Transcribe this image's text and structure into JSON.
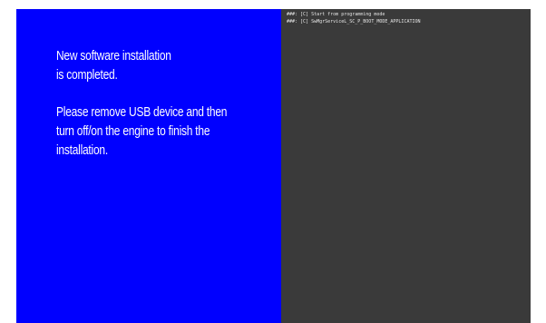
{
  "install_screen": {
    "message_line1": "New software installation",
    "message_line2": "is completed.",
    "message_line3": "Please remove USB device and then",
    "message_line4": "turn off/on the engine to finish the",
    "message_line5": "installation."
  },
  "console": {
    "lines": [
      "###: [C] Start from programming mode",
      "###: [C] SwMgrServiceL_SC_P_BOOT_MODE_APPLICATION"
    ]
  },
  "colors": {
    "panel_background": "#0000ff",
    "console_background": "#3a3a3a",
    "message_text": "#ffffff"
  }
}
